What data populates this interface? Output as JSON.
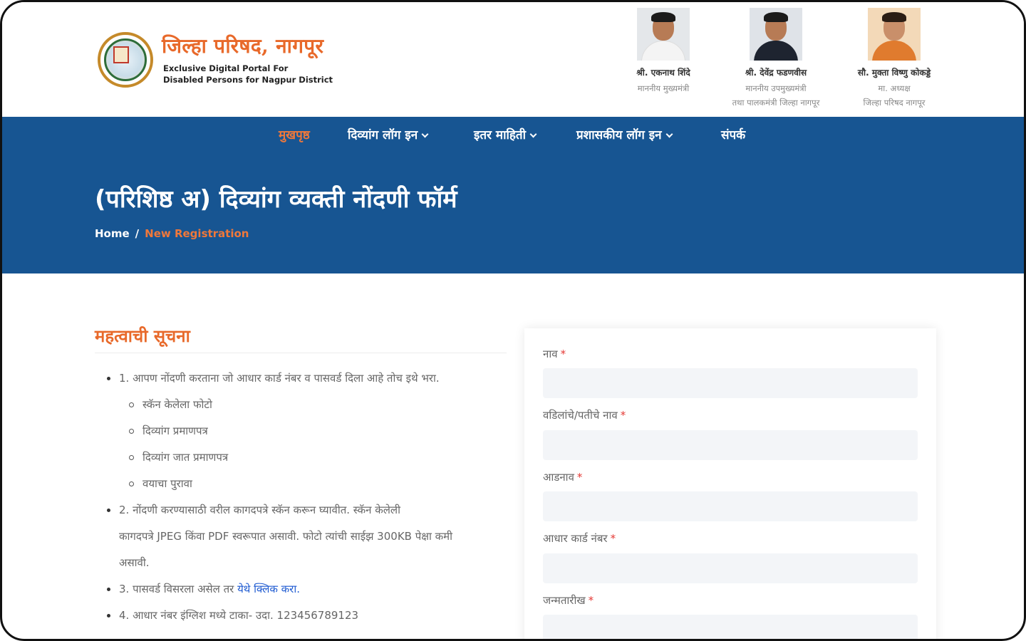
{
  "header": {
    "title": "जिल्हा परिषद, नागपूर",
    "subtitle_line1": "Exclusive Digital Portal For",
    "subtitle_line2": "Disabled Persons for Nagpur District",
    "leaders": [
      {
        "name": "श्री. एकनाथ शिंदे",
        "role": "माननीय मुख्यमंत्री",
        "role2": ""
      },
      {
        "name": "श्री. देवेंद्र फडणवीस",
        "role": "माननीय उपमुख्यमंत्री",
        "role2": "तथा पालकमंत्री जिल्हा नागपूर"
      },
      {
        "name": "सौ. मुक्ता विष्णु कोकड्डे",
        "role": "मा. अध्यक्ष",
        "role2": "जिल्हा परिषद नागपूर"
      }
    ]
  },
  "nav": {
    "items": [
      {
        "label": "मुखपृष्ठ",
        "active": true,
        "dropdown": false
      },
      {
        "label": "दिव्यांग लॉग इन",
        "active": false,
        "dropdown": true
      },
      {
        "label": "इतर माहिती",
        "active": false,
        "dropdown": true
      },
      {
        "label": "प्रशासकीय लॉग इन",
        "active": false,
        "dropdown": true
      },
      {
        "label": "संपर्क",
        "active": false,
        "dropdown": false
      }
    ]
  },
  "banner": {
    "page_title": "(परिशिष्ठ अ) दिव्यांग व्यक्ती नोंदणी फॉर्म",
    "breadcrumb": {
      "home": "Home",
      "separator": "/",
      "current": "New Registration"
    }
  },
  "notice": {
    "title": "महत्वाची सूचना",
    "item1": "1. आपण नोंदणी करताना जो आधार कार्ड नंबर व पासवर्ड दिला आहे तोच इथे भरा.",
    "sub_items": [
      "स्कॅन केलेला फोटो",
      "दिव्यांग प्रमाणपत्र",
      "दिव्यांग जात प्रमाणपत्र",
      "वयाचा पुरावा"
    ],
    "item2_line1": "2. नोंदणी करण्यासाठी वरील कागदपत्रे स्कॅन करून घ्यावीत. स्कॅन केलेली",
    "item2_line2": "कागदपत्रे JPEG किंवा PDF स्वरूपात असावी. फोटो त्यांची साईझ 300KB पेक्षा कमी",
    "item2_line3": "असावी.",
    "item3_text": "3. पासवर्ड विसरला असेल तर",
    "item3_link": "येथे क्लिक करा.",
    "item4": "4. आधार नंबर इंग्लिश मध्ये टाका- उदा. 123456789123"
  },
  "form": {
    "required_mark": "*",
    "fields": [
      {
        "label": "नाव",
        "value": ""
      },
      {
        "label": "वडिलांचे/पतीचे नाव",
        "value": ""
      },
      {
        "label": "आडनाव",
        "value": ""
      },
      {
        "label": "आधार कार्ड नंबर",
        "value": ""
      },
      {
        "label": "जन्मतारीख",
        "value": ""
      }
    ]
  },
  "colors": {
    "brand_orange": "#e8692a",
    "nav_blue": "#175592",
    "accent_orange": "#f0783a",
    "link_blue": "#1f5bd1"
  }
}
